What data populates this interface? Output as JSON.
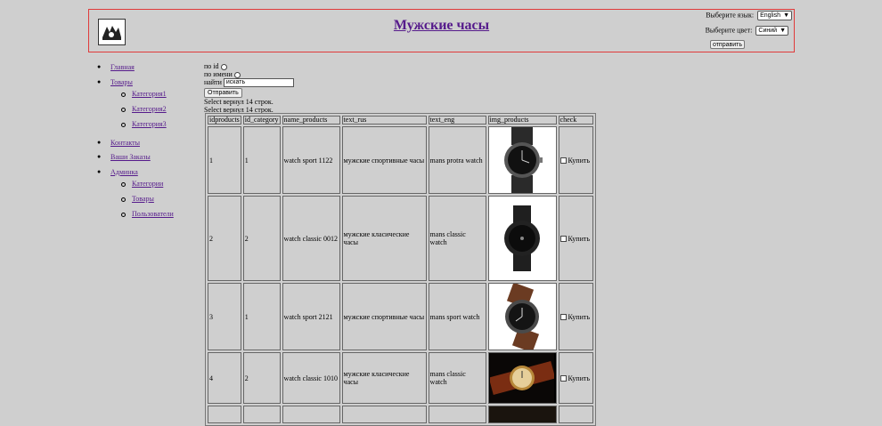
{
  "header": {
    "title": "Мужские часы",
    "lang_label": "Выберите язык:",
    "lang_value": "English",
    "color_label": "Выберите цвет:",
    "color_value": "Синий",
    "submit_label": "отправить"
  },
  "nav": {
    "items": [
      {
        "label": "Главная"
      },
      {
        "label": "Товары",
        "children": [
          {
            "label": "Категория1"
          },
          {
            "label": "Категория2"
          },
          {
            "label": "Категория3"
          }
        ]
      },
      {
        "label": "Контакты"
      },
      {
        "label": "Ваши Заказы"
      },
      {
        "label": "Админка",
        "children": [
          {
            "label": "Категории"
          },
          {
            "label": "Товары"
          },
          {
            "label": "Пользователи"
          }
        ]
      }
    ]
  },
  "form": {
    "by_id_label": "по id",
    "by_name_label": "по имени",
    "find_label": "найти",
    "search_value": "искать",
    "send_label": "Отправить",
    "result_line1": "Select вернул 14 строк.",
    "result_line2": "Select вернул 14 строк."
  },
  "table": {
    "columns": [
      "idproducts",
      "id_category",
      "name_products",
      "text_rus",
      "text_eng",
      "img_products",
      "check"
    ],
    "buy_label": "Купить",
    "rows": [
      {
        "id": "1",
        "cat": "1",
        "name": "watch sport 1122",
        "rus": "мужские спортивные часы",
        "eng": "mans protra watch",
        "img": "watch-black-steel"
      },
      {
        "id": "2",
        "cat": "2",
        "name": "watch classic 0012",
        "rus": "мужские класические часы",
        "eng": "mans classic watch",
        "img": "watch-black-round"
      },
      {
        "id": "3",
        "cat": "1",
        "name": "watch sport 2121",
        "rus": "мужские спортивные часы",
        "eng": "mans sport watch",
        "img": "watch-leather-strap"
      },
      {
        "id": "4",
        "cat": "2",
        "name": "watch classic 1010",
        "rus": "мужские класические часы",
        "eng": "mans classic watch",
        "img": "watch-gold-vintage"
      }
    ]
  }
}
